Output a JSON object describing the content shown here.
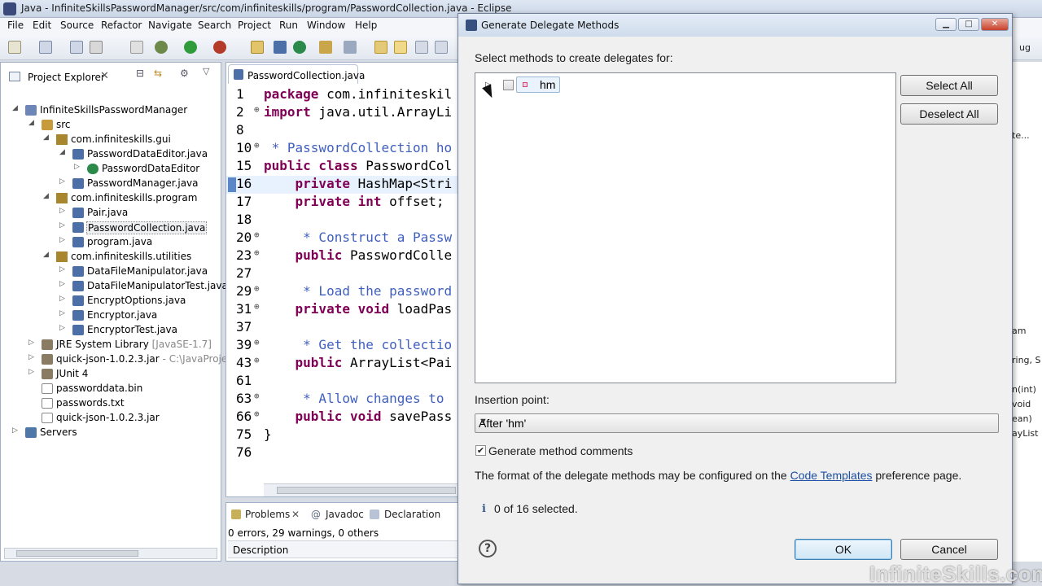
{
  "window": {
    "title": "Java - InfiniteSkillsPasswordManager/src/com/infiniteskills/program/PasswordCollection.java - Eclipse"
  },
  "menu": [
    "File",
    "Edit",
    "Source",
    "Refactor",
    "Navigate",
    "Search",
    "Project",
    "Run",
    "Window",
    "Help"
  ],
  "explorer": {
    "title": "Project Explorer",
    "tree": [
      {
        "label": "InfiniteSkillsPasswordManager",
        "icon": "project-icon"
      },
      {
        "label": "src",
        "icon": "source-folder-icon"
      },
      {
        "label": "com.infiniteskills.gui",
        "icon": "package-icon"
      },
      {
        "label": "PasswordDataEditor.java",
        "icon": "java-file-icon"
      },
      {
        "label": "PasswordDataEditor",
        "icon": "class-icon"
      },
      {
        "label": "PasswordManager.java",
        "icon": "java-file-icon"
      },
      {
        "label": "com.infiniteskills.program",
        "icon": "package-icon"
      },
      {
        "label": "Pair.java",
        "icon": "java-file-icon"
      },
      {
        "label": "PasswordCollection.java",
        "icon": "java-file-icon"
      },
      {
        "label": "program.java",
        "icon": "java-file-icon"
      },
      {
        "label": "com.infiniteskills.utilities",
        "icon": "package-icon"
      },
      {
        "label": "DataFileManipulator.java",
        "icon": "java-file-icon"
      },
      {
        "label": "DataFileManipulatorTest.java",
        "icon": "java-file-icon"
      },
      {
        "label": "EncryptOptions.java",
        "icon": "java-file-icon"
      },
      {
        "label": "Encryptor.java",
        "icon": "java-file-icon"
      },
      {
        "label": "EncryptorTest.java",
        "icon": "java-file-icon"
      },
      {
        "label": "JRE System Library",
        "decoration": "[JavaSE-1.7]",
        "icon": "library-icon"
      },
      {
        "label": "quick-json-1.0.2.3.jar",
        "decoration": "- C:\\JavaProjects",
        "icon": "library-icon"
      },
      {
        "label": "JUnit 4",
        "icon": "library-icon"
      },
      {
        "label": "passworddata.bin",
        "icon": "file-icon"
      },
      {
        "label": "passwords.txt",
        "icon": "file-icon"
      },
      {
        "label": "quick-json-1.0.2.3.jar",
        "icon": "file-icon"
      },
      {
        "label": "Servers",
        "icon": "servers-folder-icon"
      }
    ]
  },
  "editor": {
    "tab": "PasswordCollection.java",
    "lines": [
      {
        "n": "1",
        "kw": "package",
        "rest": " com.infiniteskil"
      },
      {
        "n": "2",
        "fold": "⊕",
        "kw": "import",
        "rest": " java.util.ArrayLi"
      },
      {
        "n": "8",
        "kw": "",
        "rest": ""
      },
      {
        "n": "10",
        "fold": "⊕",
        "kw": "",
        "rest": " * PasswordCollection ho",
        "comment": true
      },
      {
        "n": "15",
        "kw": "public class",
        "rest": " PasswordCol"
      },
      {
        "n": "16",
        "kw": "    private",
        "rest": " HashMap<Stri"
      },
      {
        "n": "17",
        "kw": "    private int",
        "rest": " offset;"
      },
      {
        "n": "18",
        "kw": "",
        "rest": ""
      },
      {
        "n": "20",
        "fold": "⊕",
        "kw": "",
        "rest": "     * Construct a Passw",
        "comment": true
      },
      {
        "n": "23",
        "fold": "⊕",
        "kw": "    public",
        "rest": " PasswordColle"
      },
      {
        "n": "27",
        "kw": "",
        "rest": ""
      },
      {
        "n": "29",
        "fold": "⊕",
        "kw": "",
        "rest": "     * Load the password",
        "comment": true
      },
      {
        "n": "31",
        "fold": "⊕",
        "kw": "    private void",
        "rest": " loadPas"
      },
      {
        "n": "37",
        "kw": "",
        "rest": ""
      },
      {
        "n": "39",
        "fold": "⊕",
        "kw": "",
        "rest": "     * Get the collectio",
        "comment": true
      },
      {
        "n": "43",
        "fold": "⊕",
        "kw": "    public",
        "rest": " ArrayList<Pai"
      },
      {
        "n": "61",
        "kw": "",
        "rest": ""
      },
      {
        "n": "63",
        "fold": "⊕",
        "kw": "",
        "rest": "     * Allow changes to",
        "comment": true
      },
      {
        "n": "66",
        "fold": "⊕",
        "kw": "    public void",
        "rest": " savePass"
      },
      {
        "n": "75",
        "kw": "",
        "rest": "}"
      },
      {
        "n": "76",
        "kw": "",
        "rest": ""
      }
    ]
  },
  "bottom": {
    "tabs": [
      "Problems",
      "Javadoc",
      "Declaration"
    ],
    "summary": "0 errors, 29 warnings, 0 others",
    "column": "Description"
  },
  "right_panel": [
    "ug",
    "te...",
    "am",
    "ring, S",
    "n(int)",
    "void",
    "ean)",
    "ayList"
  ],
  "dialog": {
    "title": "Generate Delegate Methods",
    "prompt": "Select methods to create delegates for:",
    "tree_item": "hm",
    "select_all": "Select All",
    "deselect_all": "Deselect All",
    "insertion_label": "Insertion point:",
    "insertion_value": "After 'hm'",
    "generate_comments": "Generate method comments",
    "generate_comments_checked": true,
    "format_text_before": "The format of the delegate methods may be configured on the",
    "format_link": "Code Templates",
    "format_text_after": "preference page.",
    "status": "0 of 16 selected.",
    "ok": "OK",
    "cancel": "Cancel"
  },
  "watermark": "InfiniteSkills.com"
}
